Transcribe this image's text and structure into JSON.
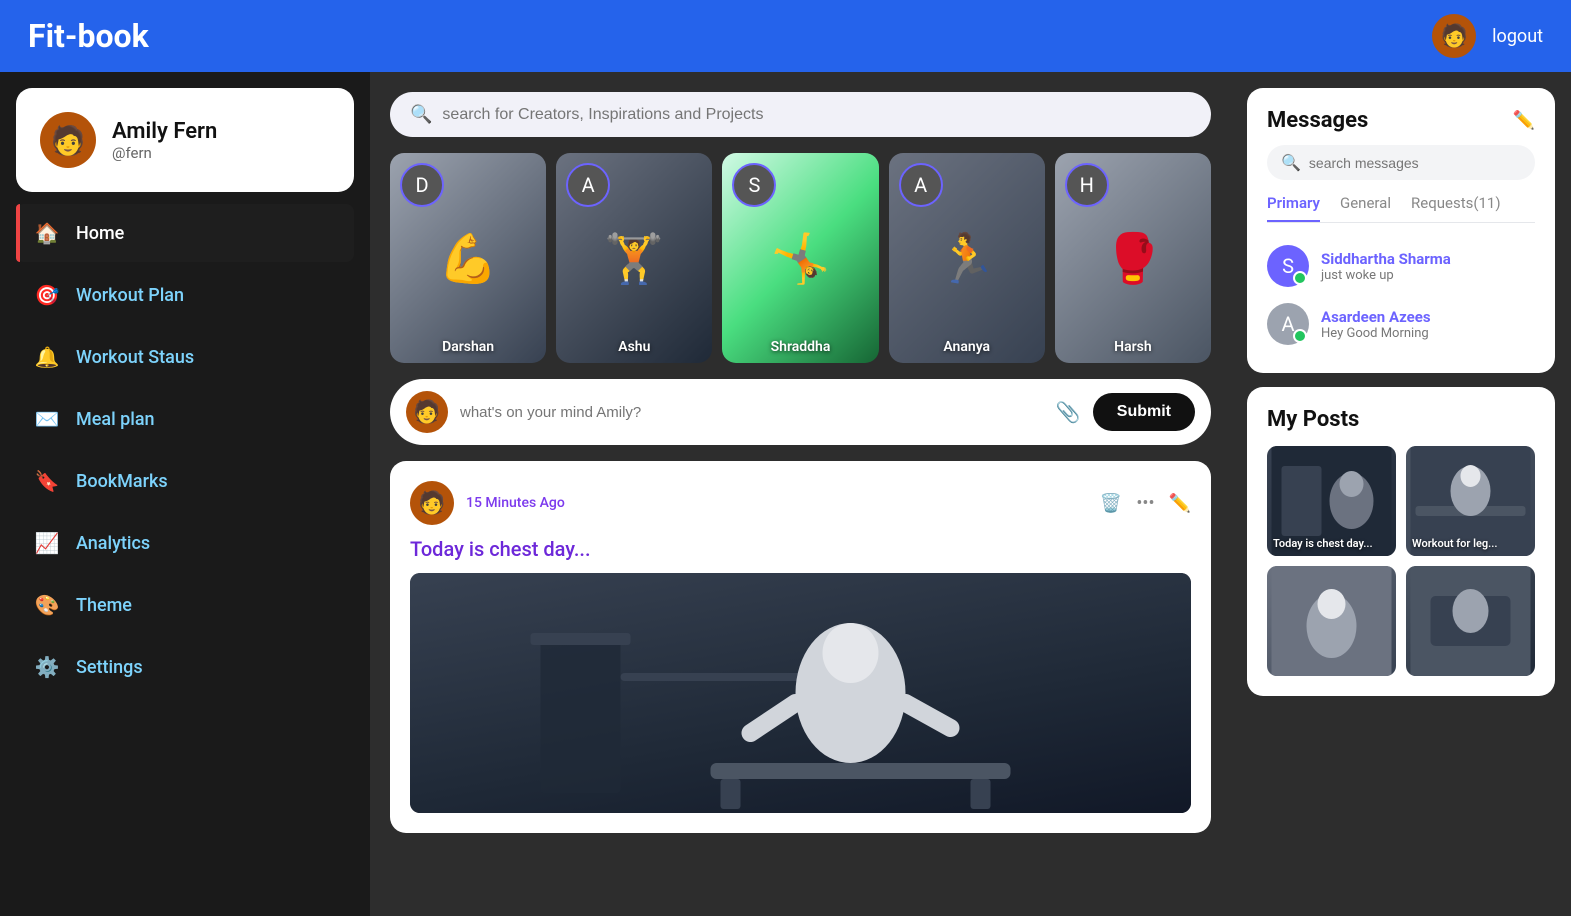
{
  "app": {
    "title": "Fit-book",
    "logout_label": "logout"
  },
  "user": {
    "name": "Amily Fern",
    "handle": "@fern",
    "avatar_emoji": "🧑"
  },
  "sidebar": {
    "items": [
      {
        "id": "home",
        "label": "Home",
        "icon": "🏠",
        "active": true,
        "icon_class": "white"
      },
      {
        "id": "workout-plan",
        "label": "Workout Plan",
        "icon": "🎯",
        "active": false,
        "icon_class": "green"
      },
      {
        "id": "workout-status",
        "label": "Workout Staus",
        "icon": "🔔",
        "active": false,
        "icon_class": "green"
      },
      {
        "id": "meal-plan",
        "label": "Meal plan",
        "icon": "✉️",
        "active": false,
        "icon_class": "green"
      },
      {
        "id": "bookmarks",
        "label": "BookMarks",
        "icon": "🔖",
        "active": false,
        "icon_class": "green"
      },
      {
        "id": "analytics",
        "label": "Analytics",
        "icon": "📈",
        "active": false,
        "icon_class": "green"
      },
      {
        "id": "theme",
        "label": "Theme",
        "icon": "🎨",
        "active": false,
        "icon_class": "green"
      },
      {
        "id": "settings",
        "label": "Settings",
        "icon": "⚙️",
        "active": false,
        "icon_class": "green"
      }
    ]
  },
  "center": {
    "search_placeholder": "search for Creators, Inspirations and Projects",
    "post_input_placeholder": "what's on your mind Amily?",
    "submit_label": "Submit",
    "creators": [
      {
        "name": "Darshan",
        "color": "c1"
      },
      {
        "name": "Ashu",
        "color": "c2"
      },
      {
        "name": "Shraddha",
        "color": "c3"
      },
      {
        "name": "Ananya",
        "color": "c4"
      },
      {
        "name": "Harsh",
        "color": "c5"
      }
    ],
    "post": {
      "time": "15 Minutes Ago",
      "title": "Today is chest day..."
    }
  },
  "messages": {
    "title": "Messages",
    "search_placeholder": "search messages",
    "tabs": [
      {
        "id": "primary",
        "label": "Primary",
        "active": true
      },
      {
        "id": "general",
        "label": "General",
        "active": false
      },
      {
        "id": "requests",
        "label": "Requests(11)",
        "active": false
      }
    ],
    "conversations": [
      {
        "name": "Siddhartha Sharma",
        "preview": "just woke up",
        "online": true,
        "avatar_class": "msg-avatar-siddhartha"
      },
      {
        "name": "Asardeen Azees",
        "preview": "Hey Good Morning",
        "online": true,
        "avatar_class": "msg-avatar-asardeen"
      }
    ]
  },
  "my_posts": {
    "title": "My Posts",
    "posts": [
      {
        "label": "Today is chest day...",
        "bg": "p1"
      },
      {
        "label": "Workout for leg...",
        "bg": "p2"
      },
      {
        "label": "",
        "bg": "p3"
      },
      {
        "label": "",
        "bg": "p4"
      }
    ]
  }
}
